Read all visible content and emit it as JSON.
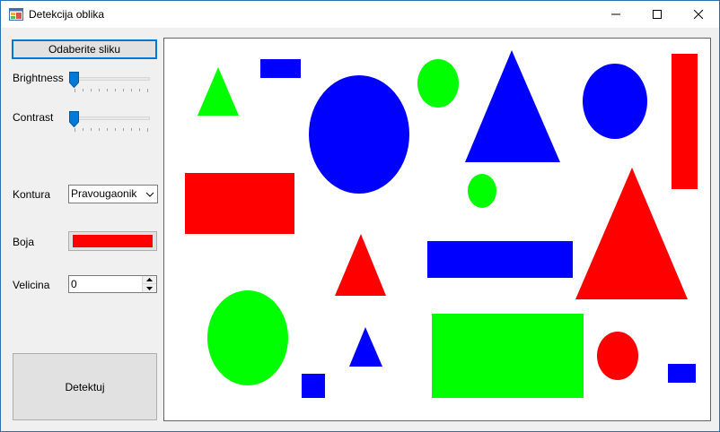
{
  "window": {
    "title": "Detekcija oblika"
  },
  "controls": {
    "load_button_label": "Odaberite sliku",
    "brightness_label": "Brightness",
    "brightness_value": 0,
    "contrast_label": "Contrast",
    "contrast_value": 0,
    "contour_label": "Kontura",
    "contour_selected": "Pravougaonik",
    "color_label": "Boja",
    "color_value": "#ff0000",
    "size_label": "Velicina",
    "size_value": "0",
    "detect_button_label": "Detektuj"
  },
  "colors": {
    "red": "#ff0000",
    "green": "#00ff00",
    "blue": "#0000ff",
    "accent": "#0078d7"
  },
  "icons": {
    "app": "app-icon",
    "minimize": "minimize-icon",
    "maximize": "maximize-icon",
    "close": "close-icon",
    "dropdown": "chevron-down-icon"
  }
}
